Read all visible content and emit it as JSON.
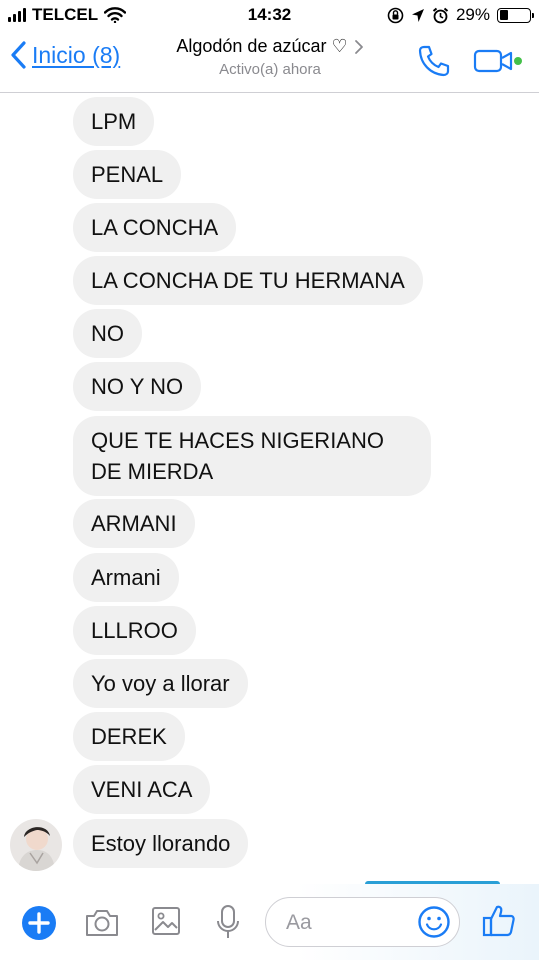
{
  "status_bar": {
    "carrier": "TELCEL",
    "time": "14:32",
    "battery": "29%",
    "battery_level": 0.29
  },
  "header": {
    "back_label": "Inicio (8)",
    "contact_name": "Algodón de azúcar ♡",
    "status": "Activo(a) ahora",
    "accent_color": "#1a7cf5",
    "online_color": "#44c04a"
  },
  "messages": [
    {
      "text": "LPM"
    },
    {
      "text": "PENAL"
    },
    {
      "text": "LA CONCHA"
    },
    {
      "text": "LA CONCHA DE TU HERMANA"
    },
    {
      "text": "NO"
    },
    {
      "text": "NO Y NO"
    },
    {
      "text": "QUE TE HACES NIGERIANO DE MIERDA"
    },
    {
      "text": "ARMANI"
    },
    {
      "text": "Armani"
    },
    {
      "text": "LLLROO"
    },
    {
      "text": "Yo voy a llorar"
    },
    {
      "text": "DEREK"
    },
    {
      "text": "VENI ACA"
    },
    {
      "text": "Estoy llorando"
    }
  ],
  "composer": {
    "placeholder": "Aa",
    "icons": [
      "plus-icon",
      "camera-icon",
      "photo-icon",
      "microphone-icon",
      "emoji-icon",
      "thumbs-up-icon"
    ]
  }
}
